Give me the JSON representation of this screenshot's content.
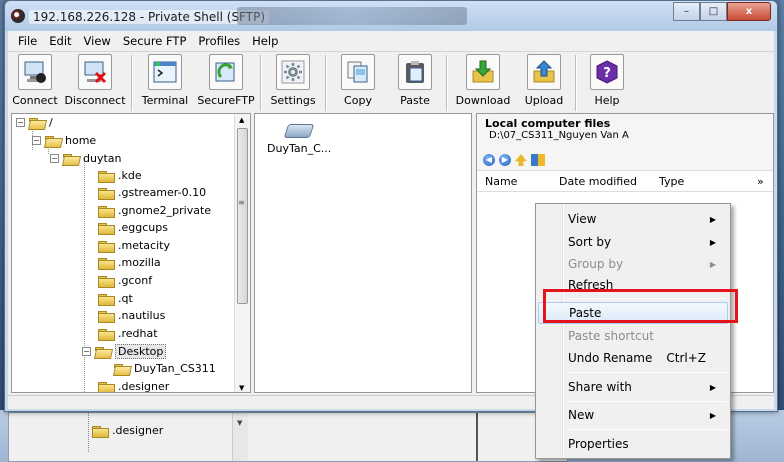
{
  "window": {
    "title": "192.168.226.128 - Private Shell (SFTP)",
    "controls": {
      "minimize": "–",
      "maximize": "□",
      "close": "x"
    }
  },
  "menu": [
    "File",
    "Edit",
    "View",
    "Secure FTP",
    "Profiles",
    "Help"
  ],
  "toolbar": [
    {
      "label": "Connect",
      "icon": "connect-icon"
    },
    {
      "label": "Disconnect",
      "icon": "disconnect-icon"
    },
    {
      "label": "Terminal",
      "icon": "terminal-icon"
    },
    {
      "label": "SecureFTP",
      "icon": "secure-ftp-icon"
    },
    {
      "label": "Settings",
      "icon": "settings-icon"
    },
    {
      "label": "Copy",
      "icon": "copy-icon"
    },
    {
      "label": "Paste",
      "icon": "paste-icon"
    },
    {
      "label": "Download",
      "icon": "download-icon"
    },
    {
      "label": "Upload",
      "icon": "upload-icon"
    },
    {
      "label": "Help",
      "icon": "help-icon"
    }
  ],
  "tree": [
    {
      "label": "/"
    },
    {
      "label": "home"
    },
    {
      "label": "duytan"
    },
    {
      "label": ".kde"
    },
    {
      "label": ".gstreamer-0.10"
    },
    {
      "label": ".gnome2_private"
    },
    {
      "label": ".eggcups"
    },
    {
      "label": ".metacity"
    },
    {
      "label": ".mozilla"
    },
    {
      "label": ".gconf"
    },
    {
      "label": ".qt"
    },
    {
      "label": ".nautilus"
    },
    {
      "label": ".redhat"
    },
    {
      "label": "Desktop"
    },
    {
      "label": "DuyTan_CS311"
    },
    {
      "label": ".designer"
    }
  ],
  "remote": {
    "item": "DuyTan_C..."
  },
  "local": {
    "title": "Local computer files",
    "path": "D:\\07_CS311_Nguyen Van A",
    "columns": [
      "Name",
      "Date modified",
      "Type"
    ],
    "overflow": "»"
  },
  "context_menu": [
    {
      "label": "View",
      "submenu": true
    },
    {
      "label": "Sort by",
      "submenu": true
    },
    {
      "label": "Group by",
      "submenu": true,
      "disabled": true
    },
    {
      "label": "Refresh"
    },
    {
      "label": "Paste"
    },
    {
      "label": "Paste shortcut",
      "disabled": true
    },
    {
      "label": "Undo Rename",
      "shortcut": "Ctrl+Z"
    },
    {
      "label": "Share with",
      "submenu": true
    },
    {
      "label": "New",
      "submenu": true
    },
    {
      "label": "Properties"
    }
  ],
  "background": {
    "folder": ".designer"
  },
  "colors": {
    "highlight_box": "#e3141c",
    "titlebar": "#b2c9e6"
  }
}
